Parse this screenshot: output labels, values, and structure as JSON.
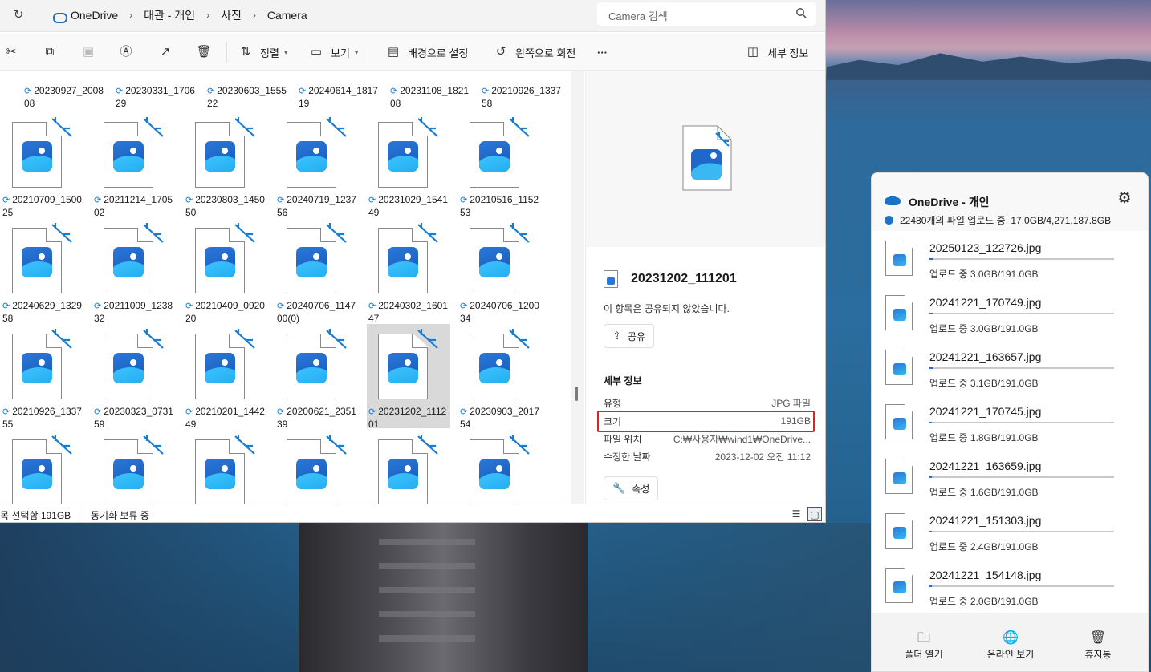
{
  "breadcrumb": {
    "items": [
      "OneDrive",
      "태관 - 개인",
      "사진",
      "Camera"
    ],
    "separator": "›"
  },
  "search": {
    "placeholder": "Camera 검색"
  },
  "toolbar": {
    "sort_label": "정렬",
    "view_label": "보기",
    "wallpaper_label": "배경으로 설정",
    "rotate_label": "왼쪽으로 회전",
    "more_label": "···",
    "details_label": "세부 정보"
  },
  "files": {
    "top_row": [
      "20230927_200808",
      "20230331_170629",
      "20230603_155522",
      "20240614_181719",
      "20231108_182108",
      "20210926_133758"
    ],
    "rows": [
      [
        "20210709_150025",
        "20211214_170502",
        "20230803_145050",
        "20240719_123756",
        "20231029_154149",
        "20210516_115253"
      ],
      [
        "20240629_132958",
        "20211009_123832",
        "20210409_092020",
        "20240706_114700(0)",
        "20240302_160147",
        "20240706_120034"
      ],
      [
        "20210926_133755",
        "20230323_073159",
        "20210201_144249",
        "20200621_235139",
        "20231202_111201",
        "20230903_201754"
      ],
      [
        "",
        "",
        "",
        "",
        "",
        ""
      ]
    ],
    "selected": "20231202_111201"
  },
  "details": {
    "file_name": "20231202_111201",
    "share_note": "이 항목은 공유되지 않았습니다.",
    "share_button": "공유",
    "section_title": "세부 정보",
    "rows": [
      {
        "label": "유형",
        "value": "JPG 파일"
      },
      {
        "label": "크기",
        "value": "191GB"
      },
      {
        "label": "파일 위치",
        "value": "C:₩사용자₩wind1₩OneDrive..."
      },
      {
        "label": "수정한 날짜",
        "value": "2023-12-02 오전 11:12"
      }
    ],
    "properties_button": "속성"
  },
  "statusbar": {
    "selected": "목 선택함 191GB",
    "sync": "동기화 보류 중"
  },
  "onedrive": {
    "title": "OneDrive - 개인",
    "status": "22480개의 파일 업로드 중, 17.0GB/4,271,187.8GB",
    "uploads": [
      {
        "name": "20250123_122726.jpg",
        "progress": "업로드 중 3.0GB/191.0GB",
        "fraction": 0.016
      },
      {
        "name": "20241221_170749.jpg",
        "progress": "업로드 중 3.0GB/191.0GB",
        "fraction": 0.016
      },
      {
        "name": "20241221_163657.jpg",
        "progress": "업로드 중 3.1GB/191.0GB",
        "fraction": 0.016
      },
      {
        "name": "20241221_170745.jpg",
        "progress": "업로드 중 1.8GB/191.0GB",
        "fraction": 0.009
      },
      {
        "name": "20241221_163659.jpg",
        "progress": "업로드 중 1.6GB/191.0GB",
        "fraction": 0.008
      },
      {
        "name": "20241221_151303.jpg",
        "progress": "업로드 중 2.4GB/191.0GB",
        "fraction": 0.013
      },
      {
        "name": "20241221_154148.jpg",
        "progress": "업로드 중 2.0GB/191.0GB",
        "fraction": 0.01
      }
    ],
    "footer": {
      "open_folder": "폴더 열기",
      "view_online": "온라인 보기",
      "recycle_bin": "휴지통"
    }
  },
  "colors": {
    "accent": "#1a73c9",
    "highlight": "#dd2222",
    "selection": "#d9d9d9"
  }
}
